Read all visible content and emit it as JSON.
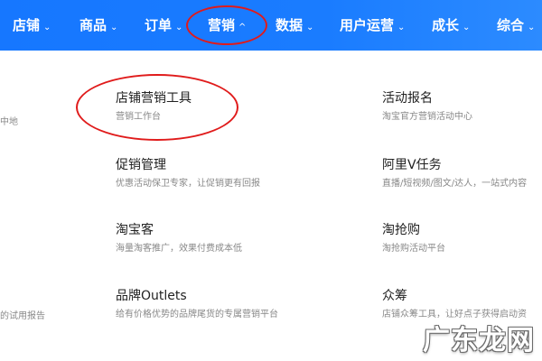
{
  "nav": {
    "items": [
      {
        "label": "店铺",
        "chevron": "⌄"
      },
      {
        "label": "商品",
        "chevron": "⌄"
      },
      {
        "label": "订单",
        "chevron": "⌄"
      },
      {
        "label": "营销",
        "chevron": "^"
      },
      {
        "label": "数据",
        "chevron": "⌄"
      },
      {
        "label": "用户运营",
        "chevron": "⌄"
      },
      {
        "label": "成长",
        "chevron": "⌄"
      },
      {
        "label": "综合",
        "chevron": "⌄"
      }
    ],
    "active": "营销",
    "accent": "#1677ff",
    "annotation_color": "#e01b1b"
  },
  "left_fragments": [
    "中地",
    "的试用报告"
  ],
  "col1": [
    {
      "title": "店铺营销工具",
      "desc": "营销工作台"
    },
    {
      "title": "促销管理",
      "desc": "优惠活动保卫专家，让促销更有回报"
    },
    {
      "title": "淘宝客",
      "desc": "海量淘客推广，效果付费成本低"
    },
    {
      "title": "品牌Outlets",
      "desc": "给有价格优势的品牌尾货的专属营销平台"
    }
  ],
  "col2": [
    {
      "title": "活动报名",
      "desc": "淘宝官方营销活动中心"
    },
    {
      "title": "阿里V任务",
      "desc": "直播/短视频/图文/达人，一站式内容"
    },
    {
      "title": "淘抢购",
      "desc": "淘抢购活动平台"
    },
    {
      "title": "众筹",
      "desc": "店铺众筹工具，让好点子获得启动资"
    }
  ],
  "watermark": "广东龙网"
}
